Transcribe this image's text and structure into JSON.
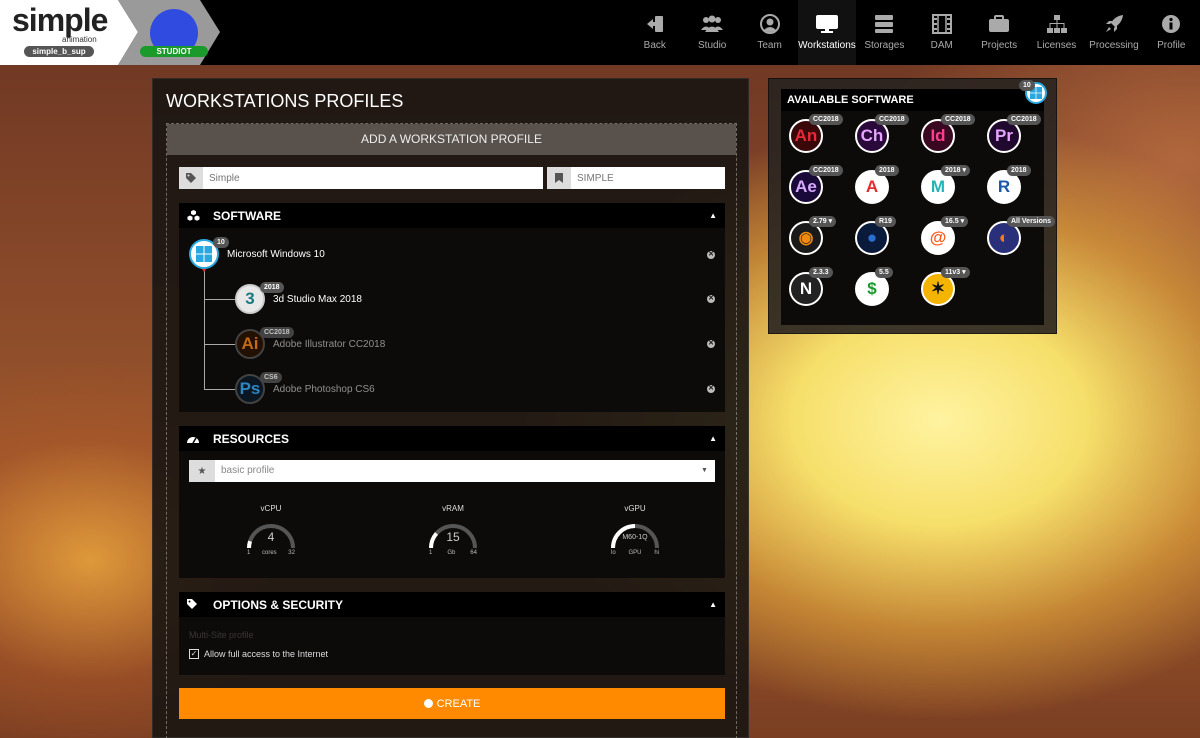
{
  "brand": {
    "logo": "simple",
    "logo_sub": "animation",
    "user": "simple_b_sup",
    "studio": "STUDIOT"
  },
  "nav": [
    {
      "label": "Back",
      "icon": "back-icon"
    },
    {
      "label": "Studio",
      "icon": "users-icon"
    },
    {
      "label": "Team",
      "icon": "user-circle-icon"
    },
    {
      "label": "Workstations",
      "icon": "monitor-icon",
      "active": true
    },
    {
      "label": "Storages",
      "icon": "storage-icon"
    },
    {
      "label": "DAM",
      "icon": "film-icon"
    },
    {
      "label": "Projects",
      "icon": "briefcase-icon"
    },
    {
      "label": "Licenses",
      "icon": "sitemap-icon"
    },
    {
      "label": "Processing",
      "icon": "rocket-icon"
    },
    {
      "label": "Profile",
      "icon": "info-icon"
    }
  ],
  "page": {
    "title": "WORKSTATIONS PROFILES",
    "form_header": "ADD A WORKSTATION PROFILE",
    "name_placeholder": "Simple",
    "code_placeholder": "SIMPLE"
  },
  "software": {
    "title": "SOFTWARE",
    "os": {
      "name": "Microsoft Windows 10",
      "version": "10",
      "icon": "windows-icon"
    },
    "apps": [
      {
        "name": "3d Studio Max 2018",
        "version": "2018",
        "icon": "3dsmax-icon",
        "dim": false
      },
      {
        "name": "Adobe Illustrator CC2018",
        "version": "CC2018",
        "icon": "illustrator-icon",
        "dim": true
      },
      {
        "name": "Adobe Photoshop CS6",
        "version": "CS6",
        "icon": "photoshop-icon",
        "dim": true
      }
    ]
  },
  "resources": {
    "title": "RESOURCES",
    "profile": "basic profile",
    "gauges": [
      {
        "label": "vCPU",
        "value": "4",
        "unit": "cores",
        "min": "1",
        "max": "32",
        "level": 0.1
      },
      {
        "label": "vRAM",
        "value": "15",
        "unit": "Gb",
        "min": "1",
        "max": "64",
        "level": 0.23
      },
      {
        "label": "vGPU",
        "value": "M60-1Q",
        "unit": "GPU",
        "min": "lo",
        "max": "hi",
        "level": 0.5
      }
    ]
  },
  "options": {
    "title": "OPTIONS & SECURITY",
    "multisite": "Multi-Site profile",
    "internet": "Allow full access to the Internet"
  },
  "create_label": "CREATE",
  "available": {
    "title": "AVAILABLE SOFTWARE",
    "os_version": "10",
    "tiles": [
      {
        "glyph": "An",
        "badge": "CC2018",
        "icon": "animate-icon",
        "color": "#e8293a",
        "bg": "#3a0808"
      },
      {
        "glyph": "Ch",
        "badge": "CC2018",
        "icon": "character-animator-icon",
        "color": "#e6a4ff",
        "bg": "#2a0a3a"
      },
      {
        "glyph": "Id",
        "badge": "CC2018",
        "icon": "indesign-icon",
        "color": "#ff3f8d",
        "bg": "#3a0820"
      },
      {
        "glyph": "Pr",
        "badge": "CC2018",
        "icon": "premiere-icon",
        "color": "#e6a4ff",
        "bg": "#20082e"
      },
      {
        "glyph": "Ae",
        "badge": "CC2018",
        "icon": "after-effects-icon",
        "color": "#d8a8ff",
        "bg": "#1a0a3a"
      },
      {
        "glyph": "A",
        "badge": "2018",
        "icon": "arnold-icon",
        "color": "#e52c2c",
        "bg": "#ffffff"
      },
      {
        "glyph": "M",
        "badge": "2018 ▾",
        "icon": "maya-icon",
        "color": "#22b3b8",
        "bg": "#ffffff"
      },
      {
        "glyph": "R",
        "badge": "2018",
        "icon": "revit-icon",
        "color": "#1a5aa8",
        "bg": "#ffffff"
      },
      {
        "glyph": "◉",
        "badge": "2.79 ▾",
        "icon": "blender-icon",
        "color": "#f08a10",
        "bg": "#1a1a1a"
      },
      {
        "glyph": "●",
        "badge": "R19",
        "icon": "cinema4d-icon",
        "color": "#2a6ed0",
        "bg": "#0a1a3a"
      },
      {
        "glyph": "@",
        "badge": "16.5 ▾",
        "icon": "houdini-icon",
        "color": "#ff5a1a",
        "bg": "#ffffff"
      },
      {
        "glyph": "◐",
        "badge": "All Versions",
        "icon": "firefox-icon",
        "color": "#ff7a10",
        "bg": "#2a2f7a"
      },
      {
        "glyph": "N",
        "badge": "2.3.3",
        "icon": "nuke-studio-icon",
        "color": "#ffffff",
        "bg": "#222222"
      },
      {
        "glyph": "$",
        "badge": "5.5",
        "icon": "cashflow-icon",
        "color": "#1a9a2a",
        "bg": "#ffffff"
      },
      {
        "glyph": "✶",
        "badge": "11v3 ▾",
        "icon": "nuke-icon",
        "color": "#111111",
        "bg": "#f5b400"
      }
    ]
  }
}
